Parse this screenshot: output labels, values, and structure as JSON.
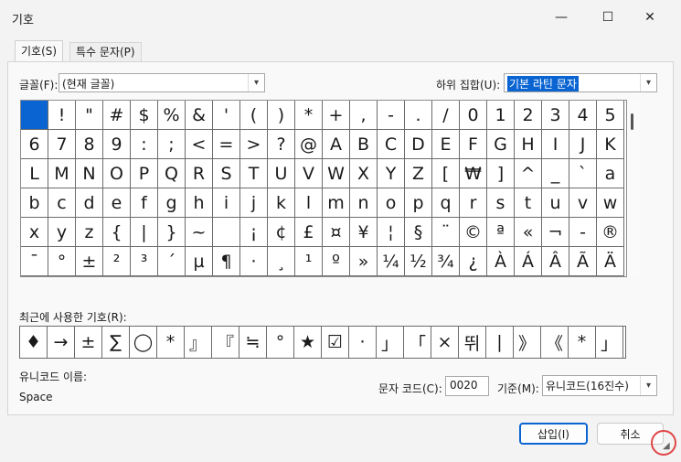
{
  "window": {
    "title": "기호",
    "minimize": "—",
    "maximize": "☐",
    "close": "✕"
  },
  "tabs": [
    {
      "label": "기호(S)"
    },
    {
      "label": "특수 문자(P)"
    }
  ],
  "font": {
    "label": "글꼴(F):",
    "value": "(현재 글꼴)"
  },
  "subset": {
    "label": "하위 집합(U):",
    "value": "기본 라틴 문자"
  },
  "grid_rows": [
    [
      " ",
      "!",
      "\"",
      "#",
      "$",
      "%",
      "&",
      "'",
      "(",
      ")",
      "*",
      "+",
      ",",
      "-",
      ".",
      "/",
      "0",
      "1",
      "2",
      "3",
      "4",
      "5"
    ],
    [
      "6",
      "7",
      "8",
      "9",
      ":",
      ";",
      "<",
      "=",
      ">",
      "?",
      "@",
      "A",
      "B",
      "C",
      "D",
      "E",
      "F",
      "G",
      "H",
      "I",
      "J",
      "K"
    ],
    [
      "L",
      "M",
      "N",
      "O",
      "P",
      "Q",
      "R",
      "S",
      "T",
      "U",
      "V",
      "W",
      "X",
      "Y",
      "Z",
      "[",
      "₩",
      "]",
      "^",
      "_",
      "`",
      "a"
    ],
    [
      "b",
      "c",
      "d",
      "e",
      "f",
      "g",
      "h",
      "i",
      "j",
      "k",
      "l",
      "m",
      "n",
      "o",
      "p",
      "q",
      "r",
      "s",
      "t",
      "u",
      "v",
      "w"
    ],
    [
      "x",
      "y",
      "z",
      "{",
      "|",
      "}",
      "~",
      " ",
      "¡",
      "¢",
      "£",
      "¤",
      "¥",
      "¦",
      "§",
      "¨",
      "©",
      "ª",
      "«",
      "¬",
      "-",
      "®"
    ],
    [
      "¯",
      "°",
      "±",
      "²",
      "³",
      "´",
      "µ",
      "¶",
      "·",
      "¸",
      "¹",
      "º",
      "»",
      "¼",
      "½",
      "¾",
      "¿",
      "À",
      "Á",
      "Â",
      "Ã",
      "Ä"
    ]
  ],
  "recent": {
    "label": "최근에 사용한 기호(R):",
    "symbols": [
      "♦",
      "→",
      "±",
      "∑",
      "◯",
      "*",
      "』",
      "『",
      "≒",
      "°",
      "★",
      "☑",
      "·",
      "」",
      "「",
      "×",
      "뛰",
      "|",
      "》",
      "《",
      "*",
      "」"
    ]
  },
  "unicode_name": {
    "label": "유니코드 이름:",
    "value": "Space"
  },
  "char_code": {
    "label": "문자 코드(C):",
    "value": "0020"
  },
  "basis": {
    "label": "기준(M):",
    "value": "유니코드(16진수)"
  },
  "buttons": {
    "insert": "삽입(I)",
    "cancel": "취소"
  }
}
